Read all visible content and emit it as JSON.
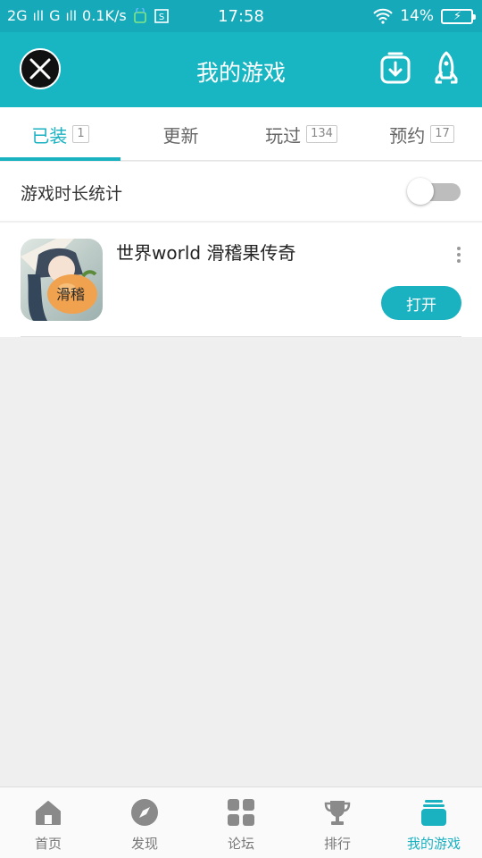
{
  "status_bar": {
    "network": "2G",
    "signal2": "G",
    "speed": "0.1K/s",
    "time": "17:58",
    "battery": "14%",
    "icons": [
      "signal-icon",
      "notification-icon",
      "sim-icon",
      "wifi-icon",
      "battery-charging-icon"
    ]
  },
  "header": {
    "title": "我的游戏",
    "icons": [
      "close-icon",
      "download-icon",
      "rocket-icon"
    ]
  },
  "tabs": [
    {
      "label": "已装",
      "count": "1",
      "active": true
    },
    {
      "label": "更新",
      "count": ""
    },
    {
      "label": "玩过",
      "count": "134"
    },
    {
      "label": "预约",
      "count": "17"
    }
  ],
  "stats_row": {
    "label": "游戏时长统计",
    "toggle_on": false
  },
  "game": {
    "name": "世界world 滑稽果传奇",
    "icon_text": "滑稽",
    "action": "打开"
  },
  "bottom_nav": [
    {
      "label": "首页",
      "icon": "home-icon"
    },
    {
      "label": "发现",
      "icon": "compass-icon"
    },
    {
      "label": "论坛",
      "icon": "grid-icon"
    },
    {
      "label": "排行",
      "icon": "trophy-icon"
    },
    {
      "label": "我的游戏",
      "icon": "stack-icon",
      "active": true
    }
  ],
  "colors": {
    "accent": "#1ab1c1",
    "header": "#18b6c2",
    "status_bar": "#16a9b9",
    "background": "#efefef"
  }
}
